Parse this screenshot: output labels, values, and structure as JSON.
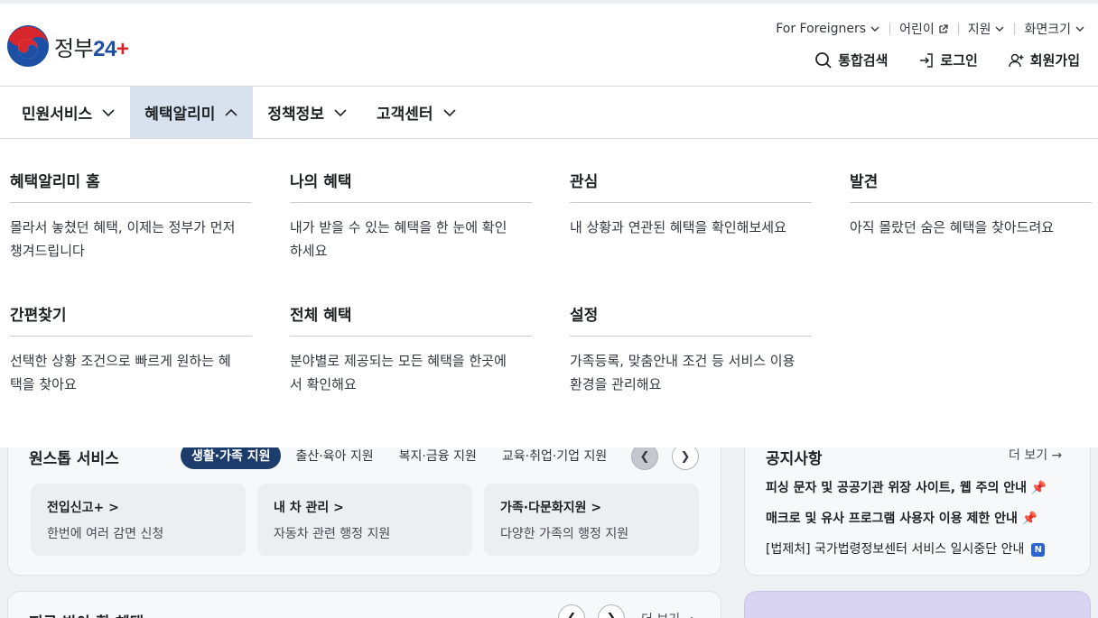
{
  "header": {
    "logo_text": "정부",
    "logo_number": "24",
    "logo_plus": "+",
    "util": {
      "foreigners": "For Foreigners",
      "kids": "어린이",
      "support": "지원",
      "screen_size": "화면크기"
    },
    "actions": {
      "search": "통합검색",
      "login": "로그인",
      "signup": "회원가입"
    }
  },
  "gnb": {
    "items": [
      {
        "label": "민원서비스"
      },
      {
        "label": "혜택알리미"
      },
      {
        "label": "정책정보"
      },
      {
        "label": "고객센터"
      }
    ]
  },
  "mega": {
    "col1": {
      "title": "혜택알리미 홈",
      "desc": "몰라서 놓쳤던 혜택, 이제는 정부가 먼저 챙겨드립니다"
    },
    "col2": {
      "title": "나의 혜택",
      "desc": "내가 받을 수 있는 혜택을 한 눈에 확인하세요"
    },
    "col3": {
      "title": "관심",
      "desc": "내 상황과 연관된 혜택을 확인해보세요"
    },
    "col4": {
      "title": "발견",
      "desc": "아직 몰랐던 숨은 혜택을 찾아드려요"
    },
    "col5": {
      "title": "간편찾기",
      "desc": "선택한 상황 조건으로 빠르게 원하는 혜택을 찾아요"
    },
    "col6": {
      "title": "전체 혜택",
      "desc": "분야별로 제공되는 모든 혜택을 한곳에서 확인해요"
    },
    "col7": {
      "title": "설정",
      "desc": "가족등록, 맞춤안내 조건 등 서비스 이용 환경을 관리해요"
    }
  },
  "background": {
    "onestop_title": "원스톱 서비스",
    "tabs": [
      "생활·가족 지원",
      "출산·육아 지원",
      "복지·금융 지원",
      "교육·취업·기업 지원"
    ],
    "services": [
      {
        "title": "전입신고+ >",
        "desc": "한번에 여러 감면 신청"
      },
      {
        "title": "내 차 관리 >",
        "desc": "자동차 관련 행정 지원"
      },
      {
        "title": "가족·다문화지원 >",
        "desc": "다양한 가족의 행정 지원"
      }
    ],
    "notice_title": "공지사항",
    "notice_more": "더 보기 →",
    "notices": [
      "피싱 문자 및 공공기관 위장 사이트, 웹 주의 안내 📌",
      "매크로 및 유사 프로그램 사용자 이용 제한 안내 📌",
      "[법제처] 국가법령정보센터 서비스 일시중단 안내"
    ],
    "notice_badge": "N",
    "bottom_title": "지금 받아 할 혜택",
    "bottom_more": "더 보기 →"
  },
  "colors": {
    "active_menu_bg": "#d8e2ee",
    "active_tab_bg": "#1c3d6c",
    "logo_blue": "#1d4fa5",
    "logo_red": "#d8262d"
  }
}
